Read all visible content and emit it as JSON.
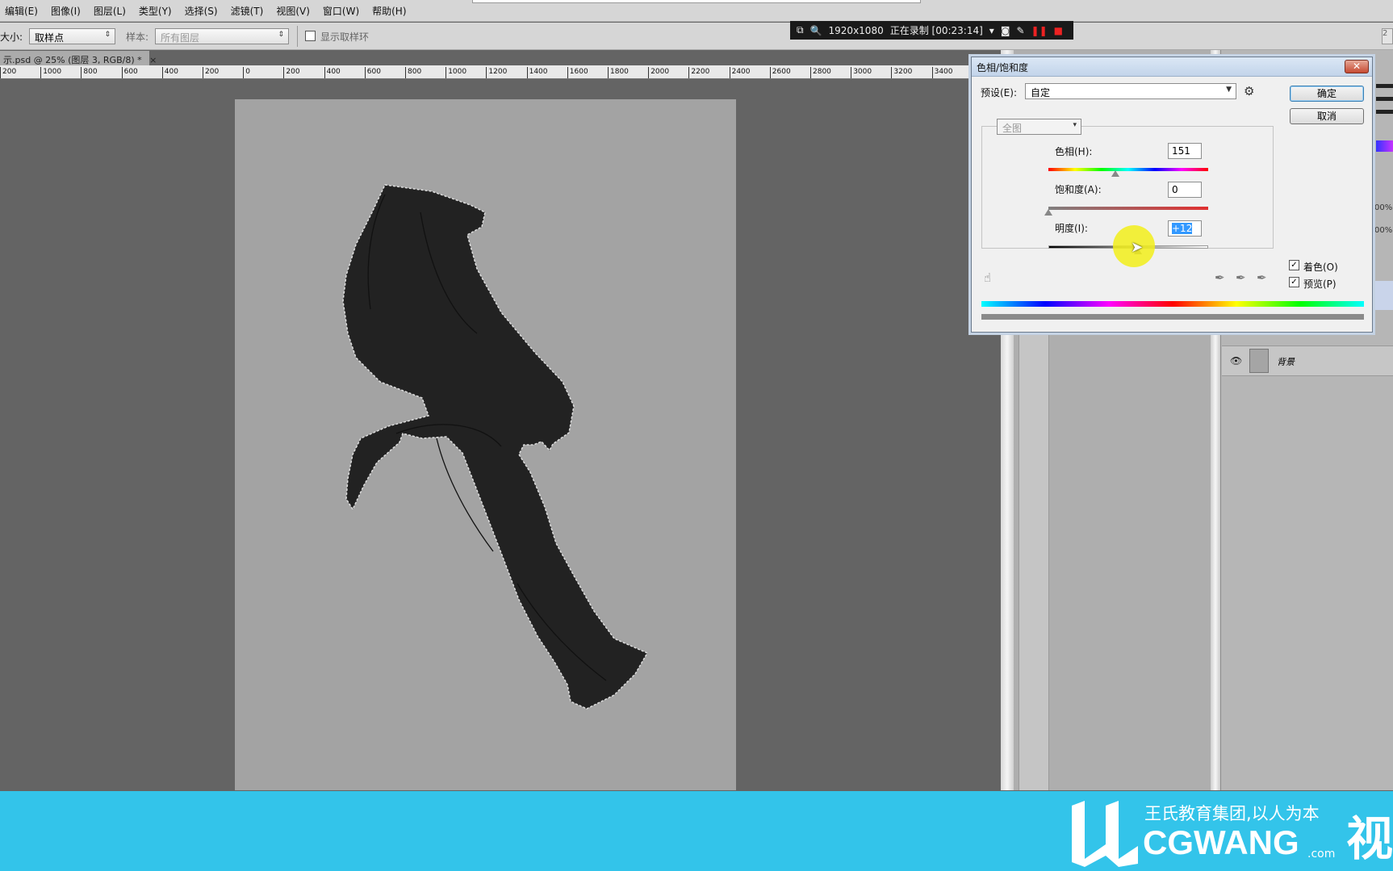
{
  "menu": [
    "编辑(E)",
    "图像(I)",
    "图层(L)",
    "类型(Y)",
    "选择(S)",
    "滤镜(T)",
    "视图(V)",
    "窗口(W)",
    "帮助(H)"
  ],
  "options": {
    "size_label": "大小:",
    "size_value": "取样点",
    "sample_label": "样本:",
    "sample_value": "所有图层",
    "show_ring": "显示取样环"
  },
  "recorder": {
    "resolution": "1920x1080",
    "status": "正在录制 [00:23:14]"
  },
  "document_tab": "示.psd @ 25% (图层 3, RGB/8) *",
  "ruler_labels": [
    "200",
    "1000",
    "800",
    "600",
    "400",
    "200",
    "0",
    "200",
    "400",
    "600",
    "800",
    "1000",
    "1200",
    "1400",
    "1600",
    "1800",
    "2000",
    "2200",
    "2400",
    "2600",
    "2800",
    "3000",
    "3200",
    "3400",
    "36"
  ],
  "dialog": {
    "title": "色相/饱和度",
    "preset_label": "预设(E):",
    "preset_value": "自定",
    "ok": "确定",
    "cancel": "取消",
    "channel": "全图",
    "hue_label": "色相(H):",
    "hue_value": "151",
    "saturation_label": "饱和度(A):",
    "saturation_value": "0",
    "lightness_label": "明度(I):",
    "lightness_value": "+12",
    "colorize_label": "着色(O)",
    "colorize_checked": true,
    "preview_label": "预览(P)",
    "preview_checked": true,
    "hue_position": 0.42,
    "saturation_position": 0.0,
    "lightness_position": 0.56
  },
  "layers": {
    "background_name": "背景"
  },
  "zoom_pct": [
    "00%",
    "00%"
  ],
  "footer": {
    "slogan": "王氏教育集团,以人为本",
    "brand": "CGWANG",
    "domain": ".com",
    "tail": "视"
  },
  "colors": {
    "footer_bg": "#33c4ea",
    "canvas_bg": "#a3a3a3",
    "figure": "#222222",
    "cursor_highlight": "#f2ef1a"
  }
}
